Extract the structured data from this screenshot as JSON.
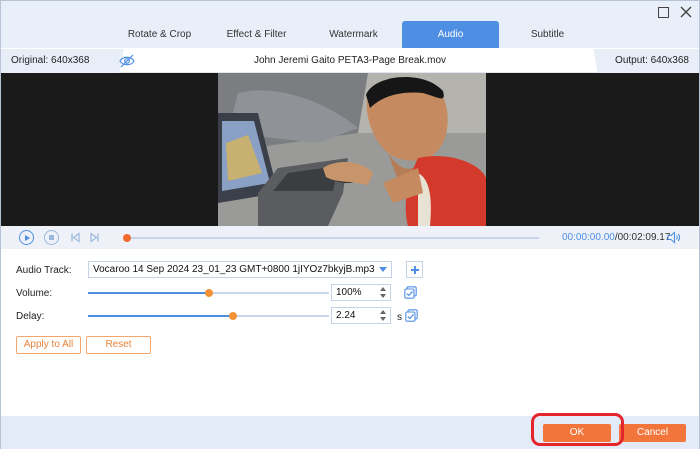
{
  "tabs": [
    {
      "label": "Rotate & Crop"
    },
    {
      "label": "Effect & Filter"
    },
    {
      "label": "Watermark"
    },
    {
      "label": "Audio"
    },
    {
      "label": "Subtitle"
    }
  ],
  "active_tab": "Audio",
  "info": {
    "original": "Original: 640x368",
    "filename": "John Jeremi Gaito PETA3-Page Break.mov",
    "output": "Output: 640x368"
  },
  "playback": {
    "current_time": "00:00:00.00",
    "total_time": "/00:02:09.17",
    "progress": 0.0
  },
  "audio": {
    "track_label": "Audio Track:",
    "track_value": "Vocaroo 14 Sep 2024 23_01_23 GMT+0800 1jIYOz7bkyjB.mp3",
    "volume_label": "Volume:",
    "volume_value": "100%",
    "volume_fraction": 0.5,
    "delay_label": "Delay:",
    "delay_value": "2.24",
    "delay_unit": "s",
    "delay_fraction": 0.6
  },
  "buttons": {
    "apply_all": "Apply to All",
    "reset": "Reset",
    "ok": "OK",
    "cancel": "Cancel"
  },
  "colors": {
    "accent": "#4f8fe3",
    "orange": "#f2763c",
    "highlight": "#e4252b"
  }
}
